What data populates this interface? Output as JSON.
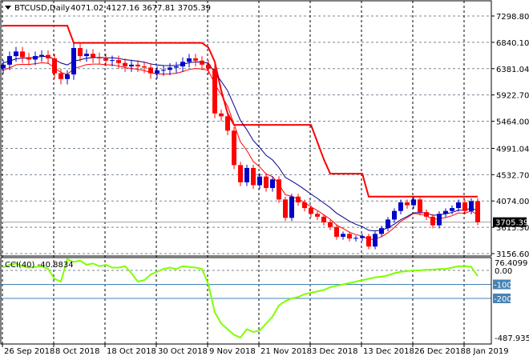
{
  "header": {
    "symbol": "BTCUSD,Daily",
    "ohlc": "4071.02 4127.16 3677.81 3705.39"
  },
  "indicator_label": "CCI(40) -40.8834",
  "colors": {
    "bull": "#0000c8",
    "bear": "#ff0000",
    "ma_slow": "#00008b",
    "ma_fast": "#ff0000",
    "channel": "#ff0000",
    "cci": "#7fff00",
    "level": "#4682b4"
  },
  "chart_data": [
    {
      "type": "candlestick",
      "title": "BTCUSD,Daily",
      "price_ticks": [
        "7298.80",
        "6840.10",
        "6381.04",
        "5922.70",
        "5464.00",
        "4991.04",
        "4532.70",
        "4074.00",
        "3615.30",
        "3156.60"
      ],
      "ylim": [
        3156.6,
        7298.8
      ],
      "current_price": "3705.39",
      "x_labels": [
        {
          "i": 0,
          "t": "26 Sep 2018"
        },
        {
          "i": 8,
          "t": "8 Oct 2018"
        },
        {
          "i": 16,
          "t": "18 Oct 2018"
        },
        {
          "i": 24,
          "t": "30 Oct 2018"
        },
        {
          "i": 32,
          "t": "9 Nov 2018"
        },
        {
          "i": 40,
          "t": "21 Nov 2018"
        },
        {
          "i": 48,
          "t": "3 Dec 2018"
        },
        {
          "i": 56,
          "t": "13 Dec 2018"
        },
        {
          "i": 64,
          "t": "26 Dec 2018"
        },
        {
          "i": 72,
          "t": "8 Jan 2019"
        }
      ],
      "close": [
        6450,
        6600,
        6680,
        6580,
        6540,
        6600,
        6620,
        6560,
        6300,
        6200,
        6280,
        6740,
        6600,
        6640,
        6580,
        6560,
        6520,
        6530,
        6480,
        6420,
        6450,
        6420,
        6400,
        6300,
        6350,
        6360,
        6400,
        6420,
        6500,
        6560,
        6520,
        6450,
        6380,
        5600,
        5550,
        5300,
        4700,
        4400,
        4650,
        4350,
        4500,
        4300,
        4450,
        4100,
        3780,
        4150,
        4050,
        3950,
        3850,
        3800,
        3700,
        3620,
        3450,
        3500,
        3420,
        3430,
        3460,
        3280,
        3500,
        3600,
        3750,
        3900,
        4050,
        4000,
        4100,
        3880,
        3800,
        3650,
        3850,
        3900,
        3950,
        4050,
        3900,
        4071.02,
        3705.39
      ],
      "channel": [
        7130,
        7130,
        7130,
        7130,
        7130,
        7130,
        7130,
        7130,
        7130,
        7130,
        7130,
        6830,
        6830,
        6830,
        6830,
        6830,
        6830,
        6830,
        6830,
        6830,
        6830,
        6830,
        6830,
        6830,
        6830,
        6830,
        6830,
        6830,
        6830,
        6830,
        6830,
        6830,
        6750,
        6500,
        6000,
        5600,
        5400,
        5400,
        5400,
        5400,
        5400,
        5400,
        5400,
        5400,
        5400,
        5400,
        5400,
        5400,
        5400,
        5100,
        4800,
        4550,
        4550,
        4550,
        4550,
        4550,
        4550,
        4150,
        4150,
        4150,
        4150,
        4150,
        4150,
        4150,
        4150,
        4150,
        4150,
        4150,
        4150,
        4150,
        4150,
        4150,
        4150,
        4150,
        4150
      ]
    },
    {
      "type": "line",
      "title": "CCI(40)",
      "y_ticks": [
        "76.4099",
        "0.00",
        "-100",
        "-200",
        "-487.935"
      ],
      "ylim": [
        -487.935,
        76.4099
      ],
      "values": [
        20,
        40,
        50,
        30,
        20,
        25,
        30,
        10,
        -60,
        -80,
        80,
        60,
        70,
        40,
        50,
        30,
        40,
        20,
        20,
        30,
        -20,
        -80,
        -70,
        -30,
        -10,
        10,
        20,
        10,
        30,
        25,
        20,
        10,
        -100,
        -300,
        -380,
        -420,
        -460,
        -480,
        -420,
        -440,
        -430,
        -380,
        -330,
        -250,
        -220,
        -200,
        -190,
        -170,
        -160,
        -150,
        -140,
        -120,
        -110,
        -100,
        -90,
        -80,
        -70,
        -60,
        -50,
        -45,
        -35,
        -20,
        -10,
        -5,
        0,
        0,
        5,
        5,
        10,
        10,
        20,
        30,
        30,
        25,
        -40.88
      ]
    }
  ]
}
